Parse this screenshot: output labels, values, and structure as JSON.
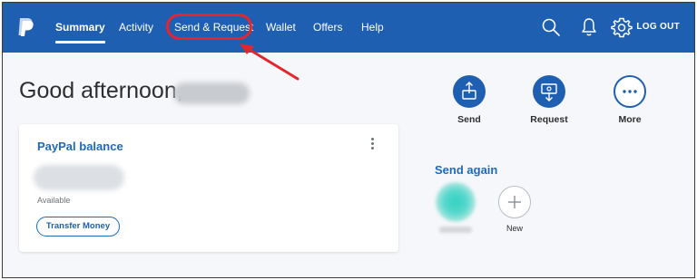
{
  "header": {
    "nav": [
      {
        "label": "Summary",
        "active": true
      },
      {
        "label": "Activity",
        "active": false
      },
      {
        "label": "Send & Request",
        "active": false,
        "highlighted": true
      },
      {
        "label": "Wallet",
        "active": false
      },
      {
        "label": "Offers",
        "active": false
      },
      {
        "label": "Help",
        "active": false
      }
    ],
    "icons": [
      "search-icon",
      "bell-icon",
      "gear-icon"
    ],
    "logout_label": "LOG OUT",
    "brand_color": "#1f5fb1"
  },
  "greeting": {
    "text": "Good afternoon,"
  },
  "balance_card": {
    "title": "PayPal balance",
    "available_label": "Available",
    "transfer_button": "Transfer Money"
  },
  "quick_actions": [
    {
      "label": "Send",
      "icon": "send-money-icon"
    },
    {
      "label": "Request",
      "icon": "request-money-icon"
    },
    {
      "label": "More",
      "icon": "more-dots-icon"
    }
  ],
  "send_again": {
    "title": "Send again",
    "new_label": "New"
  },
  "colors": {
    "accent": "#1f5fb1",
    "link": "#1f6ab8",
    "annotation": "#e3262d"
  }
}
